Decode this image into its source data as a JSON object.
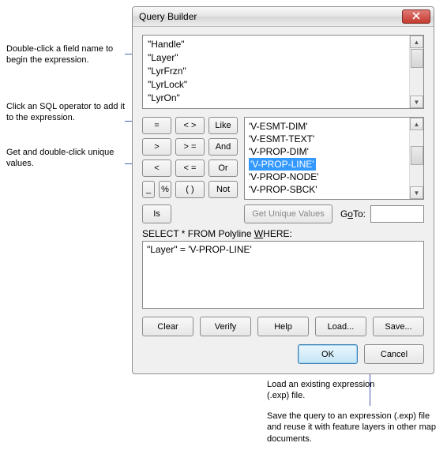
{
  "dialog": {
    "title": "Query Builder"
  },
  "fields": {
    "items": [
      "\"Handle\"",
      "\"Layer\"",
      "\"LyrFrzn\"",
      "\"LyrLock\"",
      "\"LyrOn\""
    ]
  },
  "operators": {
    "eq": "=",
    "ne": "< >",
    "like": "Like",
    "gt": ">",
    "ge": "> =",
    "and": "And",
    "lt": "<",
    "le": "< =",
    "or": "Or",
    "us": "_",
    "pct": "%",
    "par": "( )",
    "not": "Not",
    "is": "Is"
  },
  "values": {
    "items": [
      "'V-ESMT-DIM'",
      "'V-ESMT-TEXT'",
      "'V-PROP-DIM'",
      "'V-PROP-LINE'",
      "'V-PROP-NODE'",
      "'V-PROP-SBCK'"
    ],
    "highlightIndex": 3
  },
  "getUniqueValues": "Get Unique Values",
  "goToLabelPre": "G",
  "goToLabelUnderline": "o",
  "goToLabelPost": " To:",
  "selectLabelPre": "SELECT * FROM Polyline ",
  "selectLabelUnderline": "W",
  "selectLabelPost": "HERE:",
  "expression": "\"Layer\" = 'V-PROP-LINE'",
  "actions": {
    "clear": "Clear",
    "verify": "Verify",
    "help": "Help",
    "load": "Load...",
    "save": "Save..."
  },
  "okcancel": {
    "ok": "OK",
    "cancel": "Cancel"
  },
  "annotations": {
    "a1": "Double-click a field name to begin the expression.",
    "a2": "Click an SQL operator to add it to the expression.",
    "a3": "Get and double-click unique values.",
    "a4": "Load an existing expression (.exp) file.",
    "a5": "Save the query to an expression (.exp) file and reuse it with feature layers in other map documents."
  }
}
